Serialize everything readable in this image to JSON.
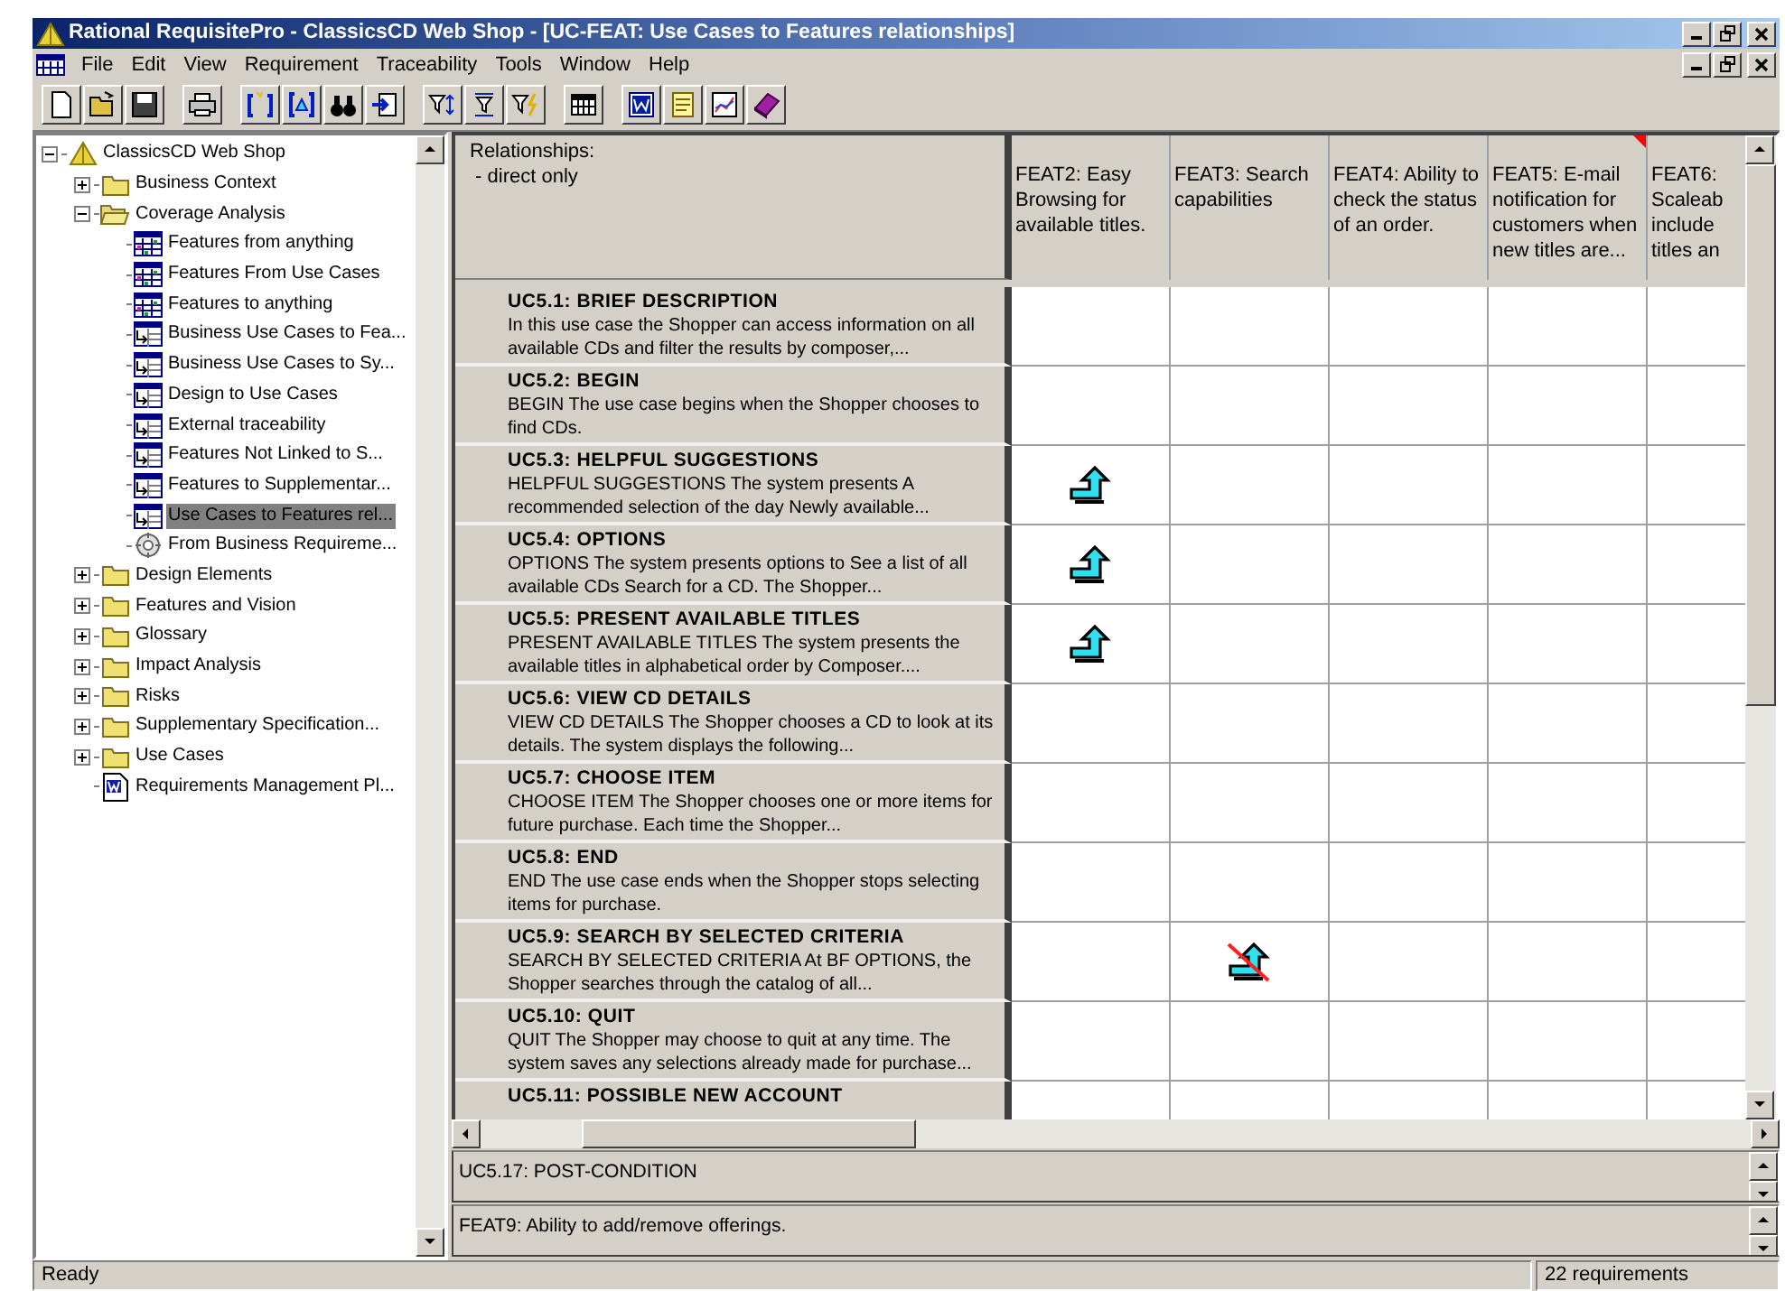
{
  "window": {
    "title": "Rational RequisitePro - ClassicsCD Web Shop - [UC-FEAT: Use Cases to Features relationships]"
  },
  "menu": [
    "File",
    "Edit",
    "View",
    "Requirement",
    "Traceability",
    "Tools",
    "Window",
    "Help"
  ],
  "tree": {
    "label": "ClassicsCD Web Shop",
    "kind": "project",
    "expanded": true,
    "selected": false,
    "children": [
      {
        "label": "Business Context",
        "kind": "folder",
        "expanded": false,
        "selected": false
      },
      {
        "label": "Coverage Analysis",
        "kind": "folder",
        "expanded": true,
        "selected": false,
        "children": [
          {
            "label": "Features from anything",
            "kind": "attribute-matrix",
            "selected": false
          },
          {
            "label": "Features From Use Cases",
            "kind": "attribute-matrix",
            "selected": false
          },
          {
            "label": "Features to anything",
            "kind": "attribute-matrix",
            "selected": false
          },
          {
            "label": "Business Use Cases to Fea...",
            "kind": "traceability-matrix",
            "selected": false
          },
          {
            "label": "Business Use Cases to Sy...",
            "kind": "traceability-matrix",
            "selected": false
          },
          {
            "label": "Design to Use Cases",
            "kind": "traceability-matrix",
            "selected": false
          },
          {
            "label": "External traceability",
            "kind": "traceability-matrix",
            "selected": false
          },
          {
            "label": "Features Not Linked to S...",
            "kind": "traceability-matrix",
            "selected": false
          },
          {
            "label": "Features to Supplementar...",
            "kind": "traceability-matrix",
            "selected": false
          },
          {
            "label": "Use Cases to Features rel...",
            "kind": "traceability-matrix",
            "selected": true
          },
          {
            "label": "From Business Requireme...",
            "kind": "traceability-tree",
            "selected": false
          }
        ]
      },
      {
        "label": "Design Elements",
        "kind": "folder",
        "expanded": false,
        "selected": false
      },
      {
        "label": "Features and Vision",
        "kind": "folder",
        "expanded": false,
        "selected": false
      },
      {
        "label": "Glossary",
        "kind": "folder",
        "expanded": false,
        "selected": false
      },
      {
        "label": "Impact Analysis",
        "kind": "folder",
        "expanded": false,
        "selected": false
      },
      {
        "label": "Risks",
        "kind": "folder",
        "expanded": false,
        "selected": false
      },
      {
        "label": "Supplementary Specification...",
        "kind": "folder",
        "expanded": false,
        "selected": false
      },
      {
        "label": "Use Cases",
        "kind": "folder",
        "expanded": false,
        "selected": false
      },
      {
        "label": "Requirements Management Pl...",
        "kind": "document",
        "selected": false
      }
    ]
  },
  "matrix": {
    "corner": [
      "Relationships:",
      " - direct only"
    ],
    "columns": [
      {
        "header": "FEAT2: Easy\nBrowsing for\navailable titles.",
        "flagged": false
      },
      {
        "header": "FEAT3: Search\ncapabilities",
        "flagged": false
      },
      {
        "header": "FEAT4: Ability to\ncheck the status\nof an order.",
        "flagged": false
      },
      {
        "header": "FEAT5: E-mail\nnotification for\ncustomers when\nnew titles are...",
        "flagged": true
      },
      {
        "header": "FEAT6:\nScaleab\ninclude\ntitles an",
        "flagged": false
      }
    ],
    "rows": [
      {
        "title": "UC5.1: BRIEF DESCRIPTION",
        "description": "In this use case the Shopper can access information on all available CDs and filter the results by composer,...",
        "links": [
          {
            "traced": false,
            "suspect": false
          },
          {
            "traced": false,
            "suspect": false
          },
          {
            "traced": false,
            "suspect": false
          },
          {
            "traced": false,
            "suspect": false
          },
          {
            "traced": false,
            "suspect": false
          }
        ]
      },
      {
        "title": "UC5.2: BEGIN",
        "description": "BEGIN  The use case begins when the Shopper chooses to find CDs.",
        "links": [
          {
            "traced": false,
            "suspect": false
          },
          {
            "traced": false,
            "suspect": false
          },
          {
            "traced": false,
            "suspect": false
          },
          {
            "traced": false,
            "suspect": false
          },
          {
            "traced": false,
            "suspect": false
          }
        ]
      },
      {
        "title": "UC5.3: HELPFUL SUGGESTIONS",
        "description": "HELPFUL SUGGESTIONS  The system presents A recommended selection of the day  Newly available...",
        "links": [
          {
            "traced": true,
            "suspect": false
          },
          {
            "traced": false,
            "suspect": false
          },
          {
            "traced": false,
            "suspect": false
          },
          {
            "traced": false,
            "suspect": false
          },
          {
            "traced": false,
            "suspect": false
          }
        ]
      },
      {
        "title": "UC5.4: OPTIONS",
        "description": "OPTIONS  The system presents options to   See a list of all available CDs   Search for a CD.   The Shopper...",
        "links": [
          {
            "traced": true,
            "suspect": false
          },
          {
            "traced": false,
            "suspect": false
          },
          {
            "traced": false,
            "suspect": false
          },
          {
            "traced": false,
            "suspect": false
          },
          {
            "traced": false,
            "suspect": false
          }
        ]
      },
      {
        "title": "UC5.5: PRESENT AVAILABLE TITLES",
        "description": "PRESENT AVAILABLE TITLES  The system presents the available titles in alphabetical order by Composer....",
        "links": [
          {
            "traced": true,
            "suspect": false
          },
          {
            "traced": false,
            "suspect": false
          },
          {
            "traced": false,
            "suspect": false
          },
          {
            "traced": false,
            "suspect": false
          },
          {
            "traced": false,
            "suspect": false
          }
        ]
      },
      {
        "title": "UC5.6: VIEW CD DETAILS",
        "description": "VIEW CD DETAILS  The Shopper chooses a CD to look at its details. The system displays the following...",
        "links": [
          {
            "traced": false,
            "suspect": false
          },
          {
            "traced": false,
            "suspect": false
          },
          {
            "traced": false,
            "suspect": false
          },
          {
            "traced": false,
            "suspect": false
          },
          {
            "traced": false,
            "suspect": false
          }
        ]
      },
      {
        "title": "UC5.7: CHOOSE ITEM",
        "description": "CHOOSE ITEM  The Shopper chooses one or more items for future purchase. Each time the Shopper...",
        "links": [
          {
            "traced": false,
            "suspect": false
          },
          {
            "traced": false,
            "suspect": false
          },
          {
            "traced": false,
            "suspect": false
          },
          {
            "traced": false,
            "suspect": false
          },
          {
            "traced": false,
            "suspect": false
          }
        ]
      },
      {
        "title": "UC5.8: END",
        "description": "END  The use case ends when the Shopper stops selecting items for purchase.",
        "links": [
          {
            "traced": false,
            "suspect": false
          },
          {
            "traced": false,
            "suspect": false
          },
          {
            "traced": false,
            "suspect": false
          },
          {
            "traced": false,
            "suspect": false
          },
          {
            "traced": false,
            "suspect": false
          }
        ]
      },
      {
        "title": "UC5.9: SEARCH BY SELECTED CRITERIA",
        "description": "SEARCH BY SELECTED CRITERIA  At BF OPTIONS, the Shopper searches through the catalog of all...",
        "links": [
          {
            "traced": false,
            "suspect": false
          },
          {
            "traced": true,
            "suspect": true
          },
          {
            "traced": false,
            "suspect": false
          },
          {
            "traced": false,
            "suspect": false
          },
          {
            "traced": false,
            "suspect": false
          }
        ]
      },
      {
        "title": "UC5.10: QUIT",
        "description": "QUIT  The Shopper may choose to quit at any time. The system saves any selections already made for purchase...",
        "links": [
          {
            "traced": false,
            "suspect": false
          },
          {
            "traced": false,
            "suspect": false
          },
          {
            "traced": false,
            "suspect": false
          },
          {
            "traced": false,
            "suspect": false
          },
          {
            "traced": false,
            "suspect": false
          }
        ]
      },
      {
        "title": "UC5.11: POSSIBLE NEW ACCOUNT",
        "links": [
          {
            "traced": false,
            "suspect": false
          },
          {
            "traced": false,
            "suspect": false
          },
          {
            "traced": false,
            "suspect": false
          },
          {
            "traced": false,
            "suspect": false
          },
          {
            "traced": false,
            "suspect": false
          }
        ]
      }
    ]
  },
  "detail_panes": [
    "UC5.17: POST-CONDITION",
    "FEAT9: Ability to add/remove offerings."
  ],
  "status_bar": {
    "message": "Ready",
    "count": "22 requirements"
  }
}
